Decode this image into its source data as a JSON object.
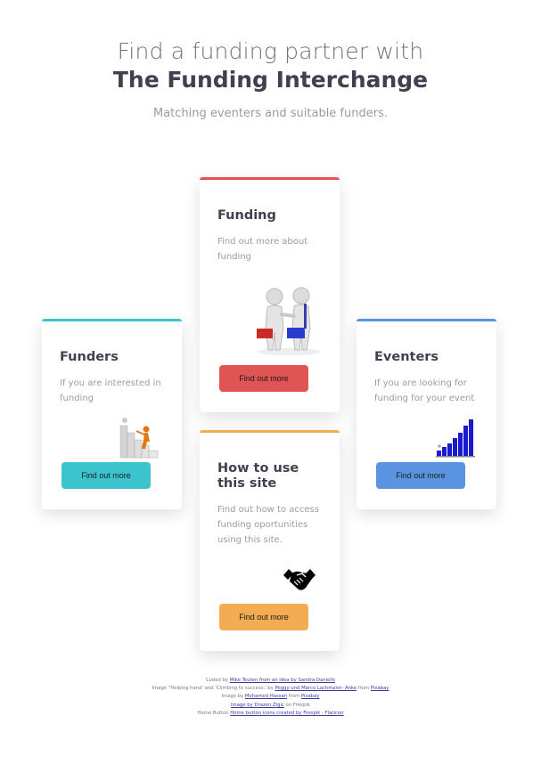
{
  "hero": {
    "line1": "Find a funding partner with",
    "line2": "The Funding Interchange",
    "subtitle": "Matching eventers and suitable funders."
  },
  "cards": {
    "funders": {
      "title": "Funders",
      "text": "If you are interested in funding",
      "button": "Find out more",
      "accent": "#3cc4ce"
    },
    "funding": {
      "title": "Funding",
      "text": "Find out more about funding",
      "button": "Find out more",
      "accent": "#e05454"
    },
    "eventers": {
      "title": "Eventers",
      "text": "If you are looking for funding for your event",
      "button": "Find out more",
      "accent": "#5a94e0"
    },
    "howto": {
      "title": "How to use this site",
      "text": "Find out how to access funding oportunities using this site.",
      "button": "Find out more",
      "accent": "#f4ac52"
    }
  },
  "footer": {
    "l1_pre": "Coded by ",
    "l1_link": "Mike Teuten from an idea by Sandra Daniells",
    "l2_pre": "Image \"Helping hand' and 'Climbing to success.' by ",
    "l2_link1": "Peggy und Marco Lachmann- Anke",
    "l2_mid": " from ",
    "l2_link2": "Pixabay",
    "l3_pre": "Image by ",
    "l3_link1": "Mohamed Hassan",
    "l3_mid": " from ",
    "l3_link2": "Pixabay",
    "l4_link": "Image by Drazen Zigic",
    "l4_post": " on Freepik",
    "l5_pre": "Home Button ",
    "l5_link": "Home button icons created by Freepik - Flaticon"
  },
  "icons": {
    "funders": "climbing-figure-icon",
    "funding": "handshake-figures-icon",
    "eventers": "rising-bars-icon",
    "howto": "handshake-icon"
  }
}
